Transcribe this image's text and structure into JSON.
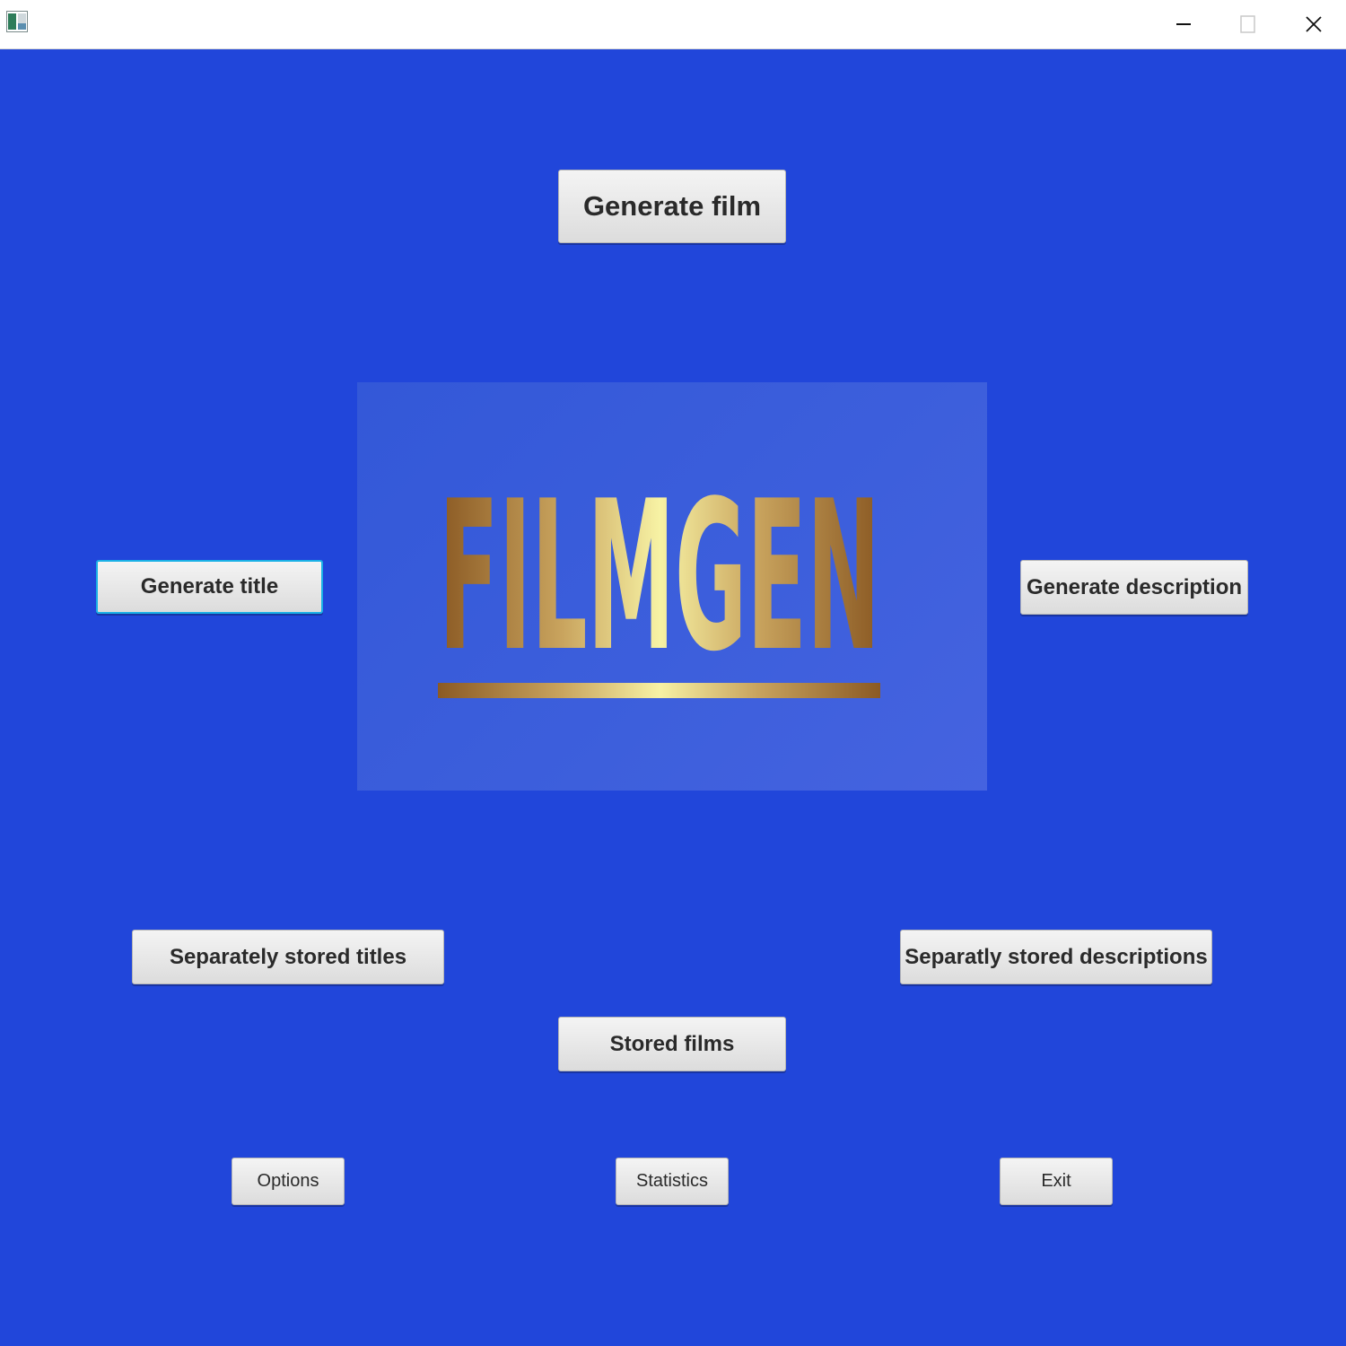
{
  "window": {
    "icon": "app-icon",
    "controls": {
      "minimize_icon": "minimize-icon",
      "maximize_icon": "maximize-icon",
      "close_icon": "close-icon"
    }
  },
  "colors": {
    "background": "#2146DA",
    "logo_gold_dark": "#8B5A24",
    "logo_gold_light": "#F7F2A4"
  },
  "logo": {
    "text": "FILMGEN"
  },
  "buttons": {
    "generate_film": "Generate film",
    "generate_title": "Generate title",
    "generate_description": "Generate description",
    "separately_stored_titles": "Separately stored titles",
    "separately_stored_descriptions": "Separatly stored descriptions",
    "stored_films": "Stored films",
    "options": "Options",
    "statistics": "Statistics",
    "exit": "Exit"
  }
}
